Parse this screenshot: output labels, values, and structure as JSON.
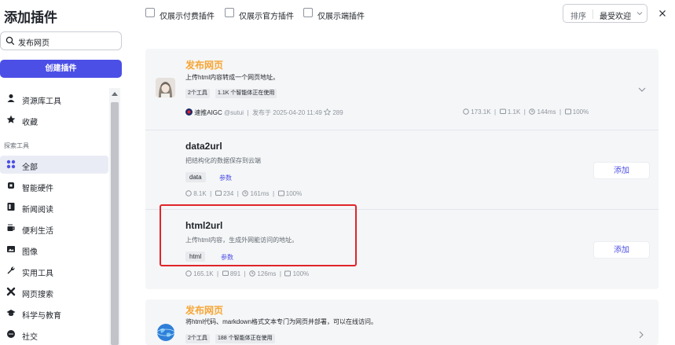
{
  "sidebar": {
    "title": "添加插件",
    "search_value": "发布网页",
    "create_button": "创建插件",
    "top_items": [
      {
        "label": "资源库工具",
        "icon": "user-icon"
      },
      {
        "label": "收藏",
        "icon": "star-icon"
      }
    ],
    "section_label": "探索工具",
    "items": [
      {
        "label": "全部",
        "icon": "grid-icon",
        "active": true
      },
      {
        "label": "智能硬件",
        "icon": "chip-icon"
      },
      {
        "label": "新闻阅读",
        "icon": "news-icon"
      },
      {
        "label": "便利生活",
        "icon": "cup-icon"
      },
      {
        "label": "图像",
        "icon": "image-icon"
      },
      {
        "label": "实用工具",
        "icon": "wrench-icon"
      },
      {
        "label": "网页搜索",
        "icon": "cross-icon"
      },
      {
        "label": "科学与教育",
        "icon": "graduation-icon"
      },
      {
        "label": "社交",
        "icon": "chat-icon"
      }
    ]
  },
  "filters": {
    "paid_only": "仅展示付费插件",
    "official_only": "仅展示官方插件",
    "endpoint_only": "仅展示端插件",
    "sort_label": "排序",
    "sort_value": "最受欢迎"
  },
  "plugin_group": {
    "title": "发布网页",
    "description": "上传html内容转成一个网页地址。",
    "tag_tools": "2个工具",
    "tag_usage": "1.1K 个智能体正在使用",
    "author": "速推AIGC",
    "handle": "@sutui",
    "published": "发布于 2025-04-20 11:49",
    "likes": "289",
    "calls": "173.1K",
    "comments": "1.1K",
    "latency": "144ms",
    "success": "100%",
    "tools": [
      {
        "name": "data2url",
        "description": "把结构化的数据保存到云端",
        "chip": "data",
        "param_label": "参数",
        "calls": "8.1K",
        "comments": "234",
        "latency": "161ms",
        "success": "100%",
        "add_label": "添加"
      },
      {
        "name": "html2url",
        "description": "上传html内容，生成外网能访问的地址。",
        "chip": "html",
        "param_label": "参数",
        "calls": "165.1K",
        "comments": "891",
        "latency": "126ms",
        "success": "100%",
        "add_label": "添加"
      }
    ]
  },
  "plugin_second": {
    "title": "发布网页",
    "description": "将html代码、markdown格式文本专门为网页并部署，可以在线访问。",
    "tag_tools": "2个工具",
    "tag_usage": "188 个智能体正在使用"
  },
  "colors": {
    "accent": "#4c4fe6",
    "title_orange": "#f7a534",
    "highlight_red": "#e0242a"
  }
}
